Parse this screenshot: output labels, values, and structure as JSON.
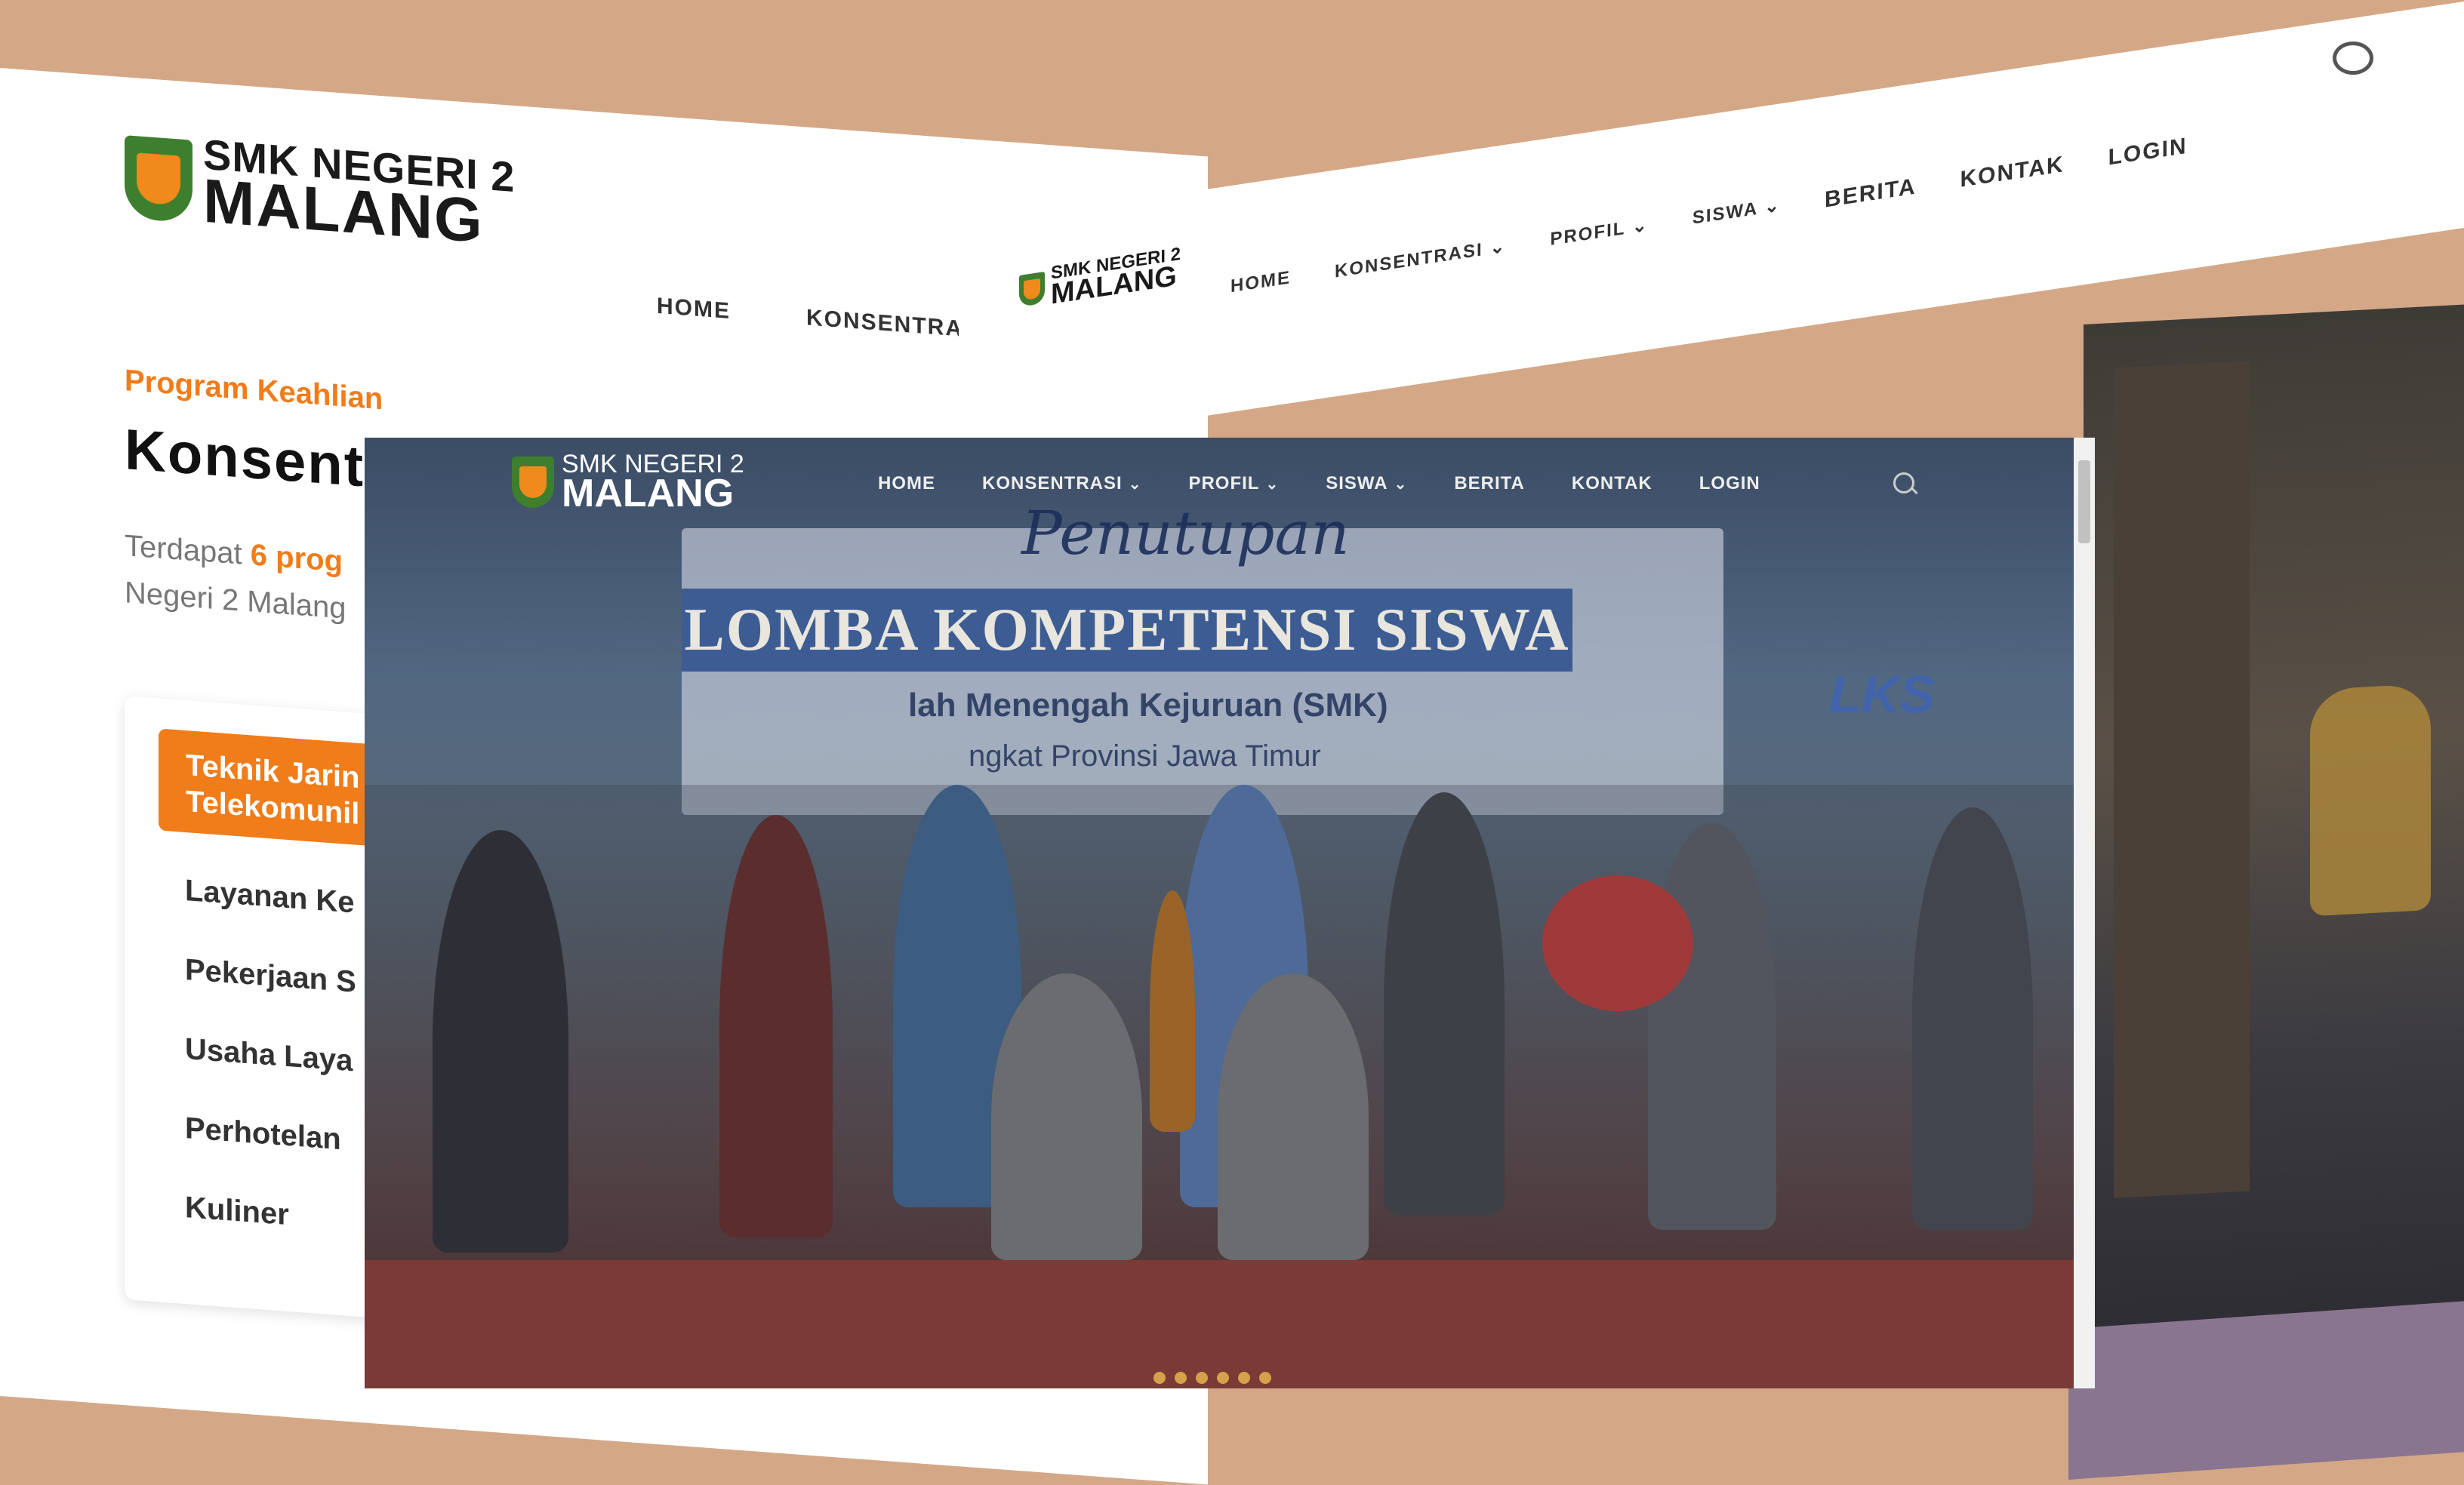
{
  "left_page": {
    "logo_top": "SMK NEGERI 2",
    "logo_bottom": "MALANG",
    "nav": [
      "HOME",
      "KONSENTRASI"
    ],
    "kicker": "Program Keahlian",
    "title": "Konsent",
    "desc_prefix": "Terdapat",
    "desc_highlight": "6 prog",
    "desc_suffix": "Negeri 2 Malang",
    "programs_active": "Teknik Jarin Telekomunil",
    "programs": [
      "Layanan Ke",
      "Pekerjaan S",
      "Usaha Laya",
      "Perhotelan",
      "Kuliner"
    ]
  },
  "right_page": {
    "logo_top": "SMK NEGERI 2",
    "logo_bottom": "MALANG",
    "nav": [
      "HOME",
      "KONSENTRASI",
      "PROFIL",
      "SISWA",
      "BERITA",
      "KONTAK",
      "LOGIN"
    ]
  },
  "main_page": {
    "logo_top": "SMK NEGERI 2",
    "logo_bottom": "MALANG",
    "nav": {
      "home": "HOME",
      "konsentrasi": "KONSENTRASI",
      "profil": "PROFIL",
      "siswa": "SISWA",
      "berita": "BERITA",
      "kontak": "KONTAK",
      "login": "LOGIN"
    },
    "hero": {
      "script": "Penutupan",
      "banner": "LOMBA KOMPETENSI SISWA",
      "sub": "lah Menengah Kejuruan (SMK)",
      "sub2": "ngkat Provinsi Jawa Timur",
      "logo_side": "LKS"
    },
    "carousel_dots": 6
  },
  "colors": {
    "accent": "#f07c1a",
    "background": "#d4a887",
    "logo_green": "#3d7f2e"
  }
}
